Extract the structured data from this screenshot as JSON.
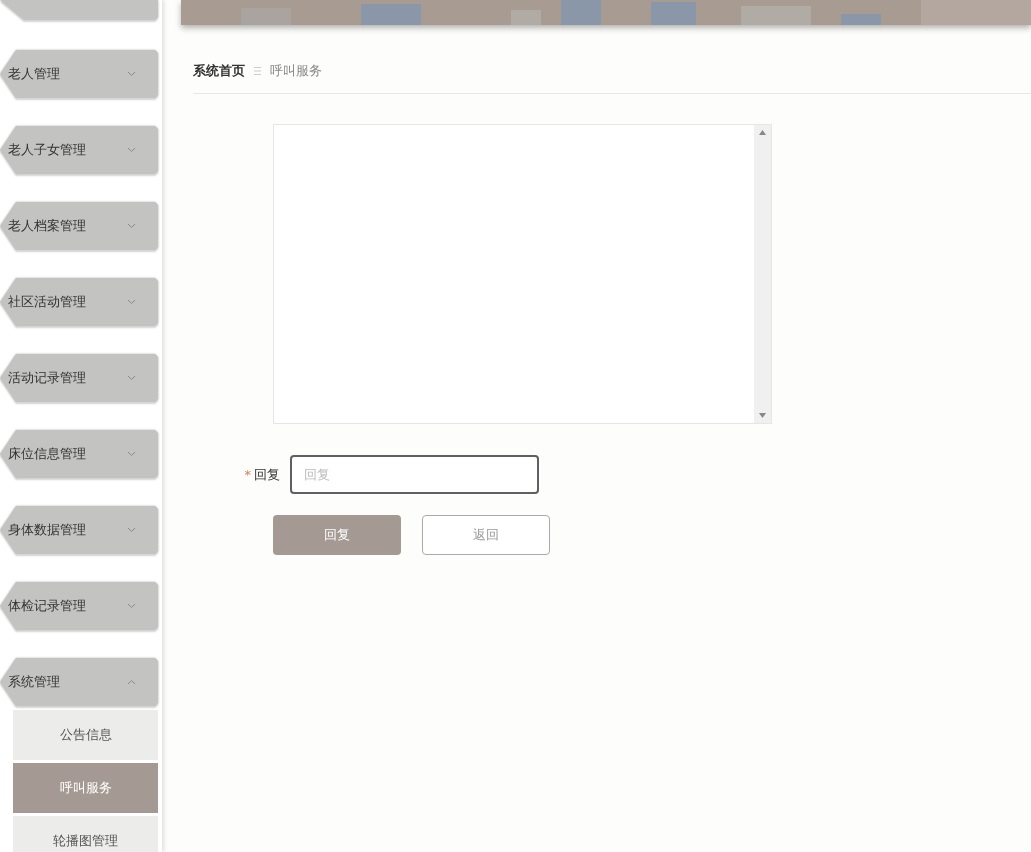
{
  "sidebar": {
    "items": [
      {
        "label": "老人管理",
        "expanded": false
      },
      {
        "label": "老人子女管理",
        "expanded": false
      },
      {
        "label": "老人档案管理",
        "expanded": false
      },
      {
        "label": "社区活动管理",
        "expanded": false
      },
      {
        "label": "活动记录管理",
        "expanded": false
      },
      {
        "label": "床位信息管理",
        "expanded": false
      },
      {
        "label": "身体数据管理",
        "expanded": false
      },
      {
        "label": "体检记录管理",
        "expanded": false
      },
      {
        "label": "系统管理",
        "expanded": true,
        "children": [
          {
            "label": "公告信息",
            "selected": false
          },
          {
            "label": "呼叫服务",
            "selected": true
          },
          {
            "label": "轮播图管理",
            "selected": false
          }
        ]
      }
    ]
  },
  "breadcrumb": [
    {
      "label": "系统首页"
    },
    {
      "label": "呼叫服务"
    }
  ],
  "form": {
    "reply": {
      "required_mark": "*",
      "label": "回复",
      "placeholder": "回复"
    },
    "buttons": [
      {
        "label": "回复",
        "kind": "primary"
      },
      {
        "label": "返回",
        "kind": "default"
      }
    ]
  }
}
